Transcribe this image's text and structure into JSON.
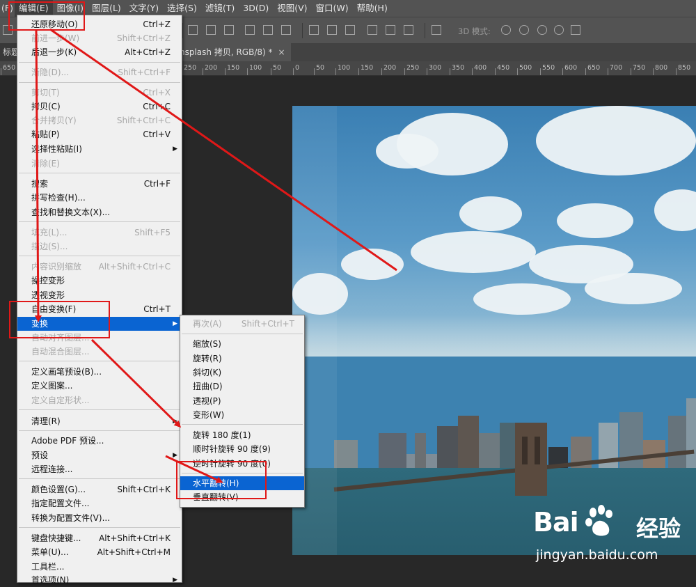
{
  "menubar": {
    "items": [
      "(F)",
      "编辑(E)",
      "图像(I)",
      "图层(L)",
      "文字(Y)",
      "选择(S)",
      "滤镜(T)",
      "3D(D)",
      "视图(V)",
      "窗口(W)",
      "帮助(H)"
    ],
    "active_index": 1
  },
  "options_bar": {
    "label_3d": "3D 模式:"
  },
  "tabs": {
    "left_tab": "标题-",
    "doc_tab": "nsplash 拷贝, RGB/8) *",
    "close_glyph": "×"
  },
  "ruler": {
    "ticks": [
      "650",
      "5",
      "250",
      "200",
      "150",
      "100",
      "50",
      "0",
      "50",
      "100",
      "150",
      "200",
      "250",
      "300",
      "350",
      "400",
      "450",
      "500",
      "550",
      "600",
      "650",
      "700",
      "750",
      "800",
      "850"
    ]
  },
  "edit_menu": {
    "items": [
      {
        "label": "还原移动(O)",
        "shortcut": "Ctrl+Z",
        "disabled": false
      },
      {
        "label": "前进一步(W)",
        "shortcut": "Shift+Ctrl+Z",
        "disabled": true
      },
      {
        "label": "后退一步(K)",
        "shortcut": "Alt+Ctrl+Z",
        "disabled": false
      },
      {
        "label": "渐隐(D)...",
        "shortcut": "Shift+Ctrl+F",
        "disabled": true
      },
      {
        "label": "剪切(T)",
        "shortcut": "Ctrl+X",
        "disabled": true
      },
      {
        "label": "拷贝(C)",
        "shortcut": "Ctrl+C",
        "disabled": false
      },
      {
        "label": "合并拷贝(Y)",
        "shortcut": "Shift+Ctrl+C",
        "disabled": true
      },
      {
        "label": "粘贴(P)",
        "shortcut": "Ctrl+V",
        "disabled": false
      },
      {
        "label": "选择性粘贴(I)",
        "shortcut": "",
        "disabled": false,
        "submenu": true
      },
      {
        "label": "清除(E)",
        "shortcut": "",
        "disabled": true
      },
      {
        "label": "搜索",
        "shortcut": "Ctrl+F",
        "disabled": false
      },
      {
        "label": "拼写检查(H)...",
        "shortcut": "",
        "disabled": false
      },
      {
        "label": "查找和替换文本(X)...",
        "shortcut": "",
        "disabled": false
      },
      {
        "label": "填充(L)...",
        "shortcut": "Shift+F5",
        "disabled": true
      },
      {
        "label": "描边(S)...",
        "shortcut": "",
        "disabled": true
      },
      {
        "label": "内容识别缩放",
        "shortcut": "Alt+Shift+Ctrl+C",
        "disabled": true
      },
      {
        "label": "操控变形",
        "shortcut": "",
        "disabled": false
      },
      {
        "label": "透视变形",
        "shortcut": "",
        "disabled": false
      },
      {
        "label": "自由变换(F)",
        "shortcut": "Ctrl+T",
        "disabled": false
      },
      {
        "label": "变换",
        "shortcut": "",
        "disabled": false,
        "submenu": true,
        "highlighted": true
      },
      {
        "label": "自动对齐图层...",
        "shortcut": "",
        "disabled": true
      },
      {
        "label": "自动混合图层...",
        "shortcut": "",
        "disabled": true
      },
      {
        "label": "定义画笔预设(B)...",
        "shortcut": "",
        "disabled": false
      },
      {
        "label": "定义图案...",
        "shortcut": "",
        "disabled": false
      },
      {
        "label": "定义自定形状...",
        "shortcut": "",
        "disabled": true
      },
      {
        "label": "清理(R)",
        "shortcut": "",
        "disabled": false,
        "submenu": true
      },
      {
        "label": "Adobe PDF 预设...",
        "shortcut": "",
        "disabled": false
      },
      {
        "label": "预设",
        "shortcut": "",
        "disabled": false,
        "submenu": true
      },
      {
        "label": "远程连接...",
        "shortcut": "",
        "disabled": false
      },
      {
        "label": "颜色设置(G)...",
        "shortcut": "Shift+Ctrl+K",
        "disabled": false
      },
      {
        "label": "指定配置文件...",
        "shortcut": "",
        "disabled": false
      },
      {
        "label": "转换为配置文件(V)...",
        "shortcut": "",
        "disabled": false
      },
      {
        "label": "键盘快捷键...",
        "shortcut": "Alt+Shift+Ctrl+K",
        "disabled": false
      },
      {
        "label": "菜单(U)...",
        "shortcut": "Alt+Shift+Ctrl+M",
        "disabled": false
      },
      {
        "label": "工具栏...",
        "shortcut": "",
        "disabled": false
      },
      {
        "label": "首选项(N)",
        "shortcut": "",
        "disabled": false,
        "submenu": true
      }
    ]
  },
  "transform_submenu": {
    "items": [
      {
        "label": "再次(A)",
        "shortcut": "Shift+Ctrl+T",
        "disabled": true
      },
      {
        "label": "缩放(S)",
        "shortcut": "",
        "disabled": false
      },
      {
        "label": "旋转(R)",
        "shortcut": "",
        "disabled": false
      },
      {
        "label": "斜切(K)",
        "shortcut": "",
        "disabled": false
      },
      {
        "label": "扭曲(D)",
        "shortcut": "",
        "disabled": false
      },
      {
        "label": "透视(P)",
        "shortcut": "",
        "disabled": false
      },
      {
        "label": "变形(W)",
        "shortcut": "",
        "disabled": false
      },
      {
        "label": "旋转 180 度(1)",
        "shortcut": "",
        "disabled": false
      },
      {
        "label": "顺时针旋转 90 度(9)",
        "shortcut": "",
        "disabled": false
      },
      {
        "label": "逆时针旋转 90 度(0)",
        "shortcut": "",
        "disabled": false
      },
      {
        "label": "水平翻转(H)",
        "shortcut": "",
        "disabled": false,
        "highlighted": true
      },
      {
        "label": "垂直翻转(V)",
        "shortcut": "",
        "disabled": false
      }
    ]
  },
  "watermark": {
    "brand": "Bai",
    "brand_cn": "经验",
    "url": "jingyan.baidu.com"
  },
  "colors": {
    "highlight": "#0a64d2",
    "annotation": "#e01818",
    "menubar": "#535353",
    "canvas_bg": "#282828"
  }
}
